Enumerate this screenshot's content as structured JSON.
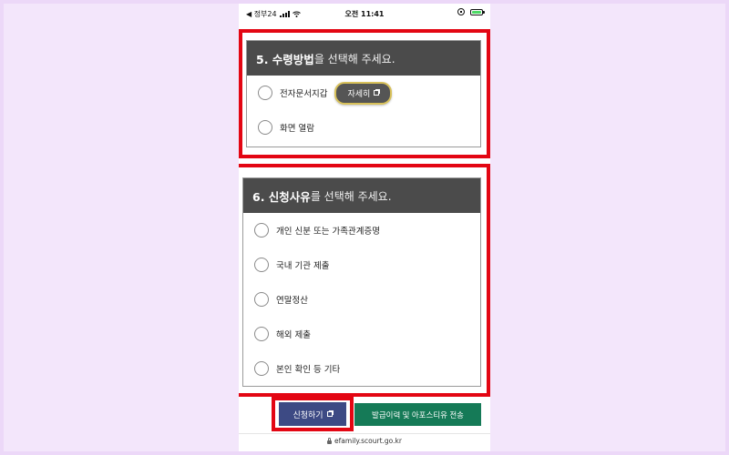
{
  "status_bar": {
    "back_label": "◀ 정부24",
    "time": "오전 11:41"
  },
  "question5": {
    "title_bold": "5. 수령방법",
    "title_rest": "을 선택해 주세요.",
    "options": [
      {
        "label": "전자문서지갑"
      },
      {
        "label": "화면 열람"
      }
    ],
    "detail_button_label": "자세히"
  },
  "question6": {
    "title_bold": "6. 신청사유",
    "title_rest": "를 선택해 주세요.",
    "options": [
      {
        "label": "개인 신분 또는 가족관계증명"
      },
      {
        "label": "국내 기관 제출"
      },
      {
        "label": "연말정산"
      },
      {
        "label": "해외 제출"
      },
      {
        "label": "본인 확인 등 기타"
      }
    ]
  },
  "footer": {
    "apply_button_label": "신청하기",
    "send_button_label": "발급이력 및 아포스티유 전송",
    "url": "efamily.scourt.go.kr"
  },
  "colors": {
    "highlight": "#e30613",
    "header_bg": "#4b4b4b",
    "apply_button": "#3d4a84",
    "send_button": "#157a57",
    "background": "#f3e6fb"
  }
}
